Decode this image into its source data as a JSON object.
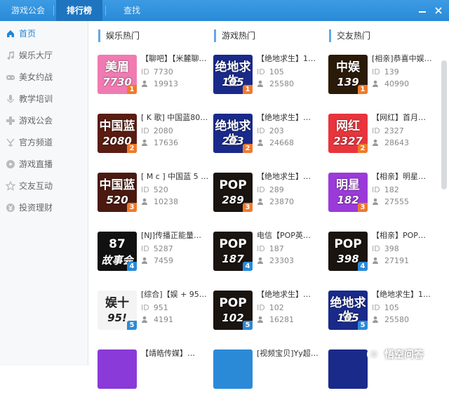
{
  "titlebar": {
    "tabs": [
      {
        "label": "游戏公会"
      },
      {
        "label": "排行榜"
      },
      {
        "label": "查找"
      }
    ],
    "minimize_icon": "minimize-icon",
    "close_icon": "close-icon"
  },
  "sidebar": {
    "items": [
      {
        "label": "首页",
        "icon": "home-icon"
      },
      {
        "label": "娱乐大厅",
        "icon": "music-icon"
      },
      {
        "label": "美女约战",
        "icon": "gamepad-icon"
      },
      {
        "label": "教学培训",
        "icon": "mic-icon"
      },
      {
        "label": "游戏公会",
        "icon": "controller-icon"
      },
      {
        "label": "官方频道",
        "icon": "yy-icon"
      },
      {
        "label": "游戏直播",
        "icon": "live-icon"
      },
      {
        "label": "交友互动",
        "icon": "star-icon"
      },
      {
        "label": "投资理财",
        "icon": "coin-icon"
      }
    ]
  },
  "columns": [
    {
      "title": "娱乐热门",
      "cards": [
        {
          "title": "【聊吧】【米麓聊…",
          "id_label": "ID",
          "id": "7730",
          "users": "19913",
          "rank": "1",
          "logo_text": "美眉",
          "logo_num": "7730",
          "bg": "#f07bb2"
        },
        {
          "title": "[ K 歌] 中国蓝80…",
          "id_label": "ID",
          "id": "2080",
          "users": "17636",
          "rank": "2",
          "logo_text": "中国蓝",
          "logo_num": "2080",
          "bg": "#5a1d12"
        },
        {
          "title": "[ M c ] 中国蓝 5 …",
          "id_label": "ID",
          "id": "520",
          "users": "10238",
          "rank": "3",
          "logo_text": "中国蓝",
          "logo_num": "520",
          "bg": "#4a1a10"
        },
        {
          "title": "[NJ]传播正能量…",
          "id_label": "ID",
          "id": "5287",
          "users": "7459",
          "rank": "4",
          "logo_text": "87",
          "logo_num": "故事会",
          "bg": "#111111"
        },
        {
          "title": "[综合]【娱 + 95…",
          "id_label": "ID",
          "id": "951",
          "users": "4191",
          "rank": "5",
          "logo_text": "娱十",
          "logo_num": "95!",
          "bg": "#f4f4f4"
        }
      ]
    },
    {
      "title": "游戏热门",
      "cards": [
        {
          "title": "【绝地求生】1…",
          "id_label": "ID",
          "id": "105",
          "users": "25580",
          "rank": "1",
          "logo_text": "绝地求生",
          "logo_num": "105",
          "bg": "#1a2a8a"
        },
        {
          "title": "【绝地求生】…",
          "id_label": "ID",
          "id": "203",
          "users": "24668",
          "rank": "2",
          "logo_text": "绝地求生",
          "logo_num": "203",
          "bg": "#1a2a8a"
        },
        {
          "title": "【绝地求生】…",
          "id_label": "ID",
          "id": "289",
          "users": "23870",
          "rank": "3",
          "logo_text": "POP",
          "logo_num": "289",
          "bg": "#1a1410"
        },
        {
          "title": "电信【POP英…",
          "id_label": "ID",
          "id": "187",
          "users": "23303",
          "rank": "4",
          "logo_text": "POP",
          "logo_num": "187",
          "bg": "#1a1410"
        },
        {
          "title": "【绝地求生】…",
          "id_label": "ID",
          "id": "102",
          "users": "16281",
          "rank": "5",
          "logo_text": "POP",
          "logo_num": "102",
          "bg": "#1a1410"
        }
      ]
    },
    {
      "title": "交友热门",
      "cards": [
        {
          "title": "[相亲]恭喜中娱…",
          "id_label": "ID",
          "id": "139",
          "users": "40990",
          "rank": "1",
          "logo_text": "中娱",
          "logo_num": "139",
          "bg": "#2a1a08"
        },
        {
          "title": "【网红】首月…",
          "id_label": "ID",
          "id": "2327",
          "users": "28643",
          "rank": "2",
          "logo_text": "网红",
          "logo_num": "2327",
          "bg": "#e8343c"
        },
        {
          "title": "【相亲】明星…",
          "id_label": "ID",
          "id": "182",
          "users": "27555",
          "rank": "3",
          "logo_text": "明星",
          "logo_num": "182",
          "bg": "#9a3ad8"
        },
        {
          "title": "【相亲】POP…",
          "id_label": "ID",
          "id": "398",
          "users": "27191",
          "rank": "4",
          "logo_text": "POP",
          "logo_num": "398",
          "bg": "#1a1410"
        },
        {
          "title": "【绝地求生】1…",
          "id_label": "ID",
          "id": "105",
          "users": "25580",
          "rank": "5",
          "logo_text": "绝地求生",
          "logo_num": "105",
          "bg": "#1a2a8a"
        }
      ]
    }
  ],
  "partial_row": [
    {
      "title": "【靖皓传媒】…",
      "bg": "#8a3ad8"
    },
    {
      "title": "[视频宝贝]Yy超…",
      "bg": "#2a8ad8"
    },
    {
      "title": "",
      "bg": "#1a2a8a"
    }
  ],
  "watermark": {
    "text": "悟空问答",
    "icon": "wukong-icon"
  },
  "colors": {
    "titlebar": "#2a8ad8",
    "active_tab": "#1e74bf",
    "accent": "#1e87d8",
    "rank_badge": "#f07a2a"
  }
}
